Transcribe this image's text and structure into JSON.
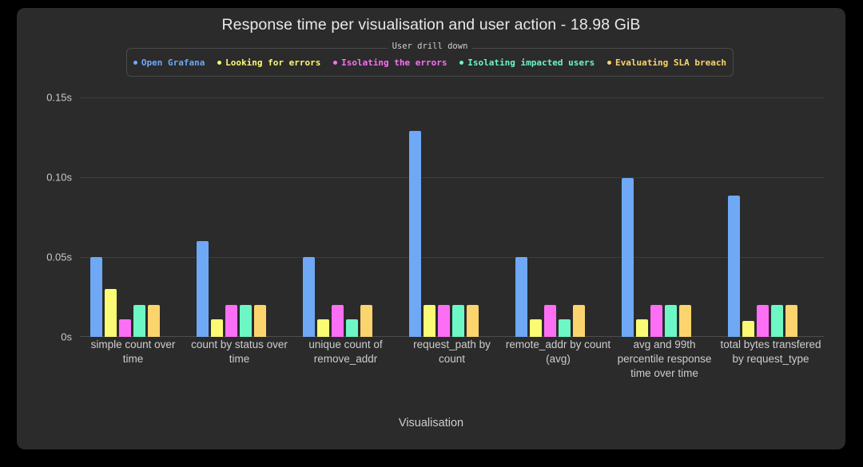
{
  "panel": {
    "title": "Response time per visualisation and user action - 18.98 GiB",
    "background": "#2b2b2b",
    "page_background": "#000000"
  },
  "legend": {
    "title": "User drill down",
    "items": [
      {
        "label": "Open Grafana",
        "color": "#6fa8f5"
      },
      {
        "label": "Looking for errors",
        "color": "#fafa74"
      },
      {
        "label": "Isolating the errors",
        "color": "#fc6ff5"
      },
      {
        "label": "Isolating impacted users",
        "color": "#6df7c4"
      },
      {
        "label": "Evaluating SLA breach",
        "color": "#fbd46d"
      }
    ]
  },
  "axes": {
    "x_title": "Visualisation",
    "y_ticks": [
      "0.15s",
      "0.10s",
      "0.05s",
      "0s"
    ],
    "y_tick_values": [
      0.15,
      0.1,
      0.05,
      0
    ]
  },
  "chart_data": {
    "type": "bar",
    "title": "Response time per visualisation and user action - 18.98 GiB",
    "xlabel": "Visualisation",
    "ylabel": "",
    "ylim": [
      0,
      0.16
    ],
    "grid": true,
    "legend_position": "top",
    "legend_title": "User drill down",
    "categories": [
      "simple count over time",
      "count by status over time",
      "unique count of remove_addr",
      "request_path by count",
      "remote_addr by count (avg)",
      "avg and 99th percentile response time over time",
      "total bytes transfered by request_type"
    ],
    "series": [
      {
        "name": "Open Grafana",
        "color": "#6fa8f5",
        "values": [
          0.05,
          0.06,
          0.05,
          0.129,
          0.05,
          0.0995,
          0.0885
        ]
      },
      {
        "name": "Looking for errors",
        "color": "#fafa74",
        "values": [
          0.03,
          0.011,
          0.011,
          0.02,
          0.011,
          0.011,
          0.01
        ]
      },
      {
        "name": "Isolating the errors",
        "color": "#fc6ff5",
        "values": [
          0.011,
          0.02,
          0.02,
          0.02,
          0.02,
          0.02,
          0.02
        ]
      },
      {
        "name": "Isolating impacted users",
        "color": "#6df7c4",
        "values": [
          0.02,
          0.02,
          0.011,
          0.02,
          0.011,
          0.02,
          0.02
        ]
      },
      {
        "name": "Evaluating SLA breach",
        "color": "#fbd46d",
        "values": [
          0.02,
          0.02,
          0.02,
          0.02,
          0.02,
          0.02,
          0.02
        ]
      }
    ]
  }
}
